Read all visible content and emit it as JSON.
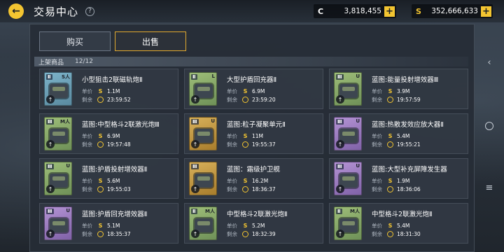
{
  "header": {
    "title": "交易中心",
    "help_icon": "question-icon",
    "back_icon": "back-arrow-icon"
  },
  "currencies": [
    {
      "symbol": "C",
      "value": "3,818,455",
      "plus": "+"
    },
    {
      "symbol": "S",
      "value": "352,666,633",
      "plus": "+"
    }
  ],
  "tabs": [
    {
      "label": "购买",
      "active": false
    },
    {
      "label": "出售",
      "active": true
    }
  ],
  "section": {
    "title": "上架商品",
    "count": "12/12"
  },
  "labels": {
    "price": "单价",
    "remaining": "剩余",
    "coin_symbol": "S"
  },
  "items": [
    {
      "name": "小型狙击2联磁轨炮Ⅱ",
      "price": "1.1M",
      "time": "23:59:52",
      "grade": "Ⅱ",
      "cat": "S人",
      "color": "blue"
    },
    {
      "name": "大型护盾回充器Ⅱ",
      "price": "6.9M",
      "time": "23:59:20",
      "grade": "Ⅱ",
      "cat": "L",
      "color": "green"
    },
    {
      "name": "蓝图:能量投射增效器Ⅲ",
      "price": "3.9M",
      "time": "19:57:59",
      "grade": "Ⅲ",
      "cat": "U",
      "color": "green"
    },
    {
      "name": "蓝图:中型格斗2联激光炮Ⅲ",
      "price": "6.9M",
      "time": "19:57:48",
      "grade": "Ⅲ",
      "cat": "M人",
      "color": "green"
    },
    {
      "name": "蓝图:粒子凝聚单元Ⅱ",
      "price": "11M",
      "time": "19:55:37",
      "grade": "Ⅲ",
      "cat": "U",
      "color": "gold"
    },
    {
      "name": "蓝图:热散发效应放大器Ⅱ",
      "price": "5.4M",
      "time": "19:55:21",
      "grade": "Ⅲ",
      "cat": "U",
      "color": "purple"
    },
    {
      "name": "蓝图:护盾投射增效器Ⅱ",
      "price": "5.6M",
      "time": "19:55:03",
      "grade": "Ⅲ",
      "cat": "U",
      "color": "green"
    },
    {
      "name": "蓝图：霜级护卫舰",
      "price": "16.2M",
      "time": "18:36:37",
      "grade": "Ⅲ",
      "cat": "",
      "color": "gold"
    },
    {
      "name": "蓝图:大型补充屏障发生器",
      "price": "1.9M",
      "time": "18:36:06",
      "grade": "Ⅲ",
      "cat": "U",
      "color": "purple"
    },
    {
      "name": "蓝图:护盾回充增效器Ⅱ",
      "price": "5.1M",
      "time": "18:35:37",
      "grade": "Ⅲ",
      "cat": "U",
      "color": "purple"
    },
    {
      "name": "中型格斗2联激光炮Ⅱ",
      "price": "5.2M",
      "time": "18:32:39",
      "grade": "Ⅱ",
      "cat": "M人",
      "color": "green"
    },
    {
      "name": "中型格斗2联激光炮Ⅱ",
      "price": "5.4M",
      "time": "18:31:30",
      "grade": "Ⅱ",
      "cat": "M人",
      "color": "green"
    }
  ]
}
